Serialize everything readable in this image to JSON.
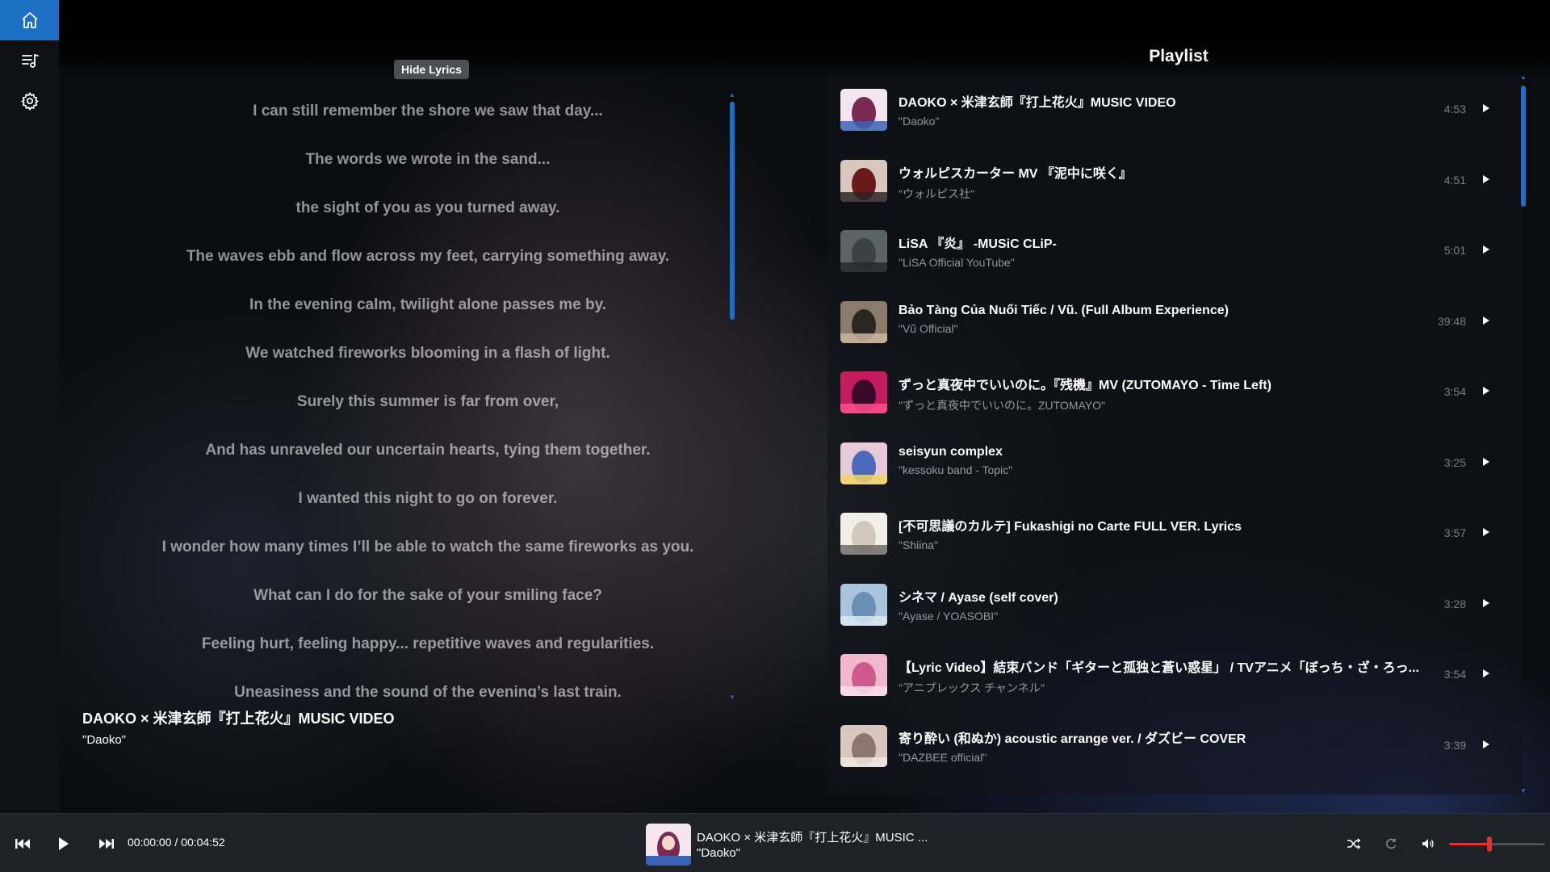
{
  "sidebar": {
    "items": [
      {
        "name": "home",
        "icon": "home-icon",
        "active": true
      },
      {
        "name": "playlist",
        "icon": "playlist-icon",
        "active": false
      },
      {
        "name": "settings",
        "icon": "gear-icon",
        "active": false
      }
    ]
  },
  "lyrics": {
    "toggle_label": "Hide Lyrics",
    "lines": [
      "I can still remember the shore we saw that day...",
      "The words we wrote in the sand...",
      "the sight of you as you turned away.",
      "The waves ebb and flow across my feet, carrying something away.",
      "In the evening calm, twilight alone passes me by.",
      "We watched fireworks blooming in a flash of light.",
      "Surely this summer is far from over,",
      "And has unraveled our uncertain hearts, tying them together.",
      "I wanted this night to go on forever.",
      "I wonder how many times I’ll be able to watch the same fireworks as you.",
      "What can I do for the sake of your smiling face?",
      "Feeling hurt, feeling happy... repetitive waves and regularities.",
      "Uneasiness and the sound of the evening’s last train."
    ],
    "scroll_position": 0.0
  },
  "now_playing": {
    "title": "DAOKO × 米津玄師『打上花火』MUSIC VIDEO",
    "artist": "\"Daoko\""
  },
  "playlist": {
    "header": "Playlist",
    "items": [
      {
        "title": "DAOKO × 米津玄師『打上花火』MUSIC VIDEO",
        "artist": "\"Daoko\"",
        "duration": "4:53",
        "thumb_colors": [
          "#f3e6ef",
          "#7a2a52",
          "#3a63b6"
        ]
      },
      {
        "title": "ウォルピスカーター MV 『泥中に咲く』",
        "artist": "\"ウォルピス社\"",
        "duration": "4:51",
        "thumb_colors": [
          "#d9c6bd",
          "#6b1a1a",
          "#2d2326"
        ]
      },
      {
        "title": "LiSA 『炎』 -MUSiC CLiP-",
        "artist": "\"LiSA Official YouTube\"",
        "duration": "5:01",
        "thumb_colors": [
          "#5b6464",
          "#3a4242",
          "#232a2a"
        ]
      },
      {
        "title": "Bảo Tàng Của Nuối Tiếc / Vũ. (Full Album Experience)",
        "artist": "\"Vũ Official\"",
        "duration": "39:48",
        "thumb_colors": [
          "#8a7b6a",
          "#2c2622",
          "#c7b7a0"
        ]
      },
      {
        "title": "ずっと真夜中でいいのに。『残機』MV (ZUTOMAYO - Time Left)",
        "artist": "\"ずっと真夜中でいいのに。ZUTOMAYO\"",
        "duration": "3:54",
        "thumb_colors": [
          "#c41c5e",
          "#3a0a2a",
          "#ff4f8e"
        ]
      },
      {
        "title": "seisyun complex",
        "artist": "\"kessoku band - Topic\"",
        "duration": "3:25",
        "thumb_colors": [
          "#e8c9d8",
          "#4a6bbb",
          "#f1d36b"
        ]
      },
      {
        "title": "[不可思議のカルテ] Fukashigi no Carte FULL VER. Lyrics",
        "artist": "\"Shiina\"",
        "duration": "3:57",
        "thumb_colors": [
          "#f2efe8",
          "#d1c7bc",
          "#6e6a65"
        ]
      },
      {
        "title": "シネマ / Ayase (self cover)",
        "artist": "\"Ayase / YOASOBI\"",
        "duration": "3:28",
        "thumb_colors": [
          "#a8c4dc",
          "#6b8fb3",
          "#dce8f2"
        ]
      },
      {
        "title": "【Lyric Video】結束バンド「ギターと孤独と蒼い惑星」 / TVアニメ「ぼっち・ざ・ろっ...",
        "artist": "\"アニプレックス チャンネル\"",
        "duration": "3:54",
        "thumb_colors": [
          "#f2b6cf",
          "#cf5a8e",
          "#f7e1ea"
        ]
      },
      {
        "title": "寄り酔い (和ぬか) acoustic arrange ver. / ダズビー COVER",
        "artist": "\"DAZBEE official\"",
        "duration": "3:39",
        "thumb_colors": [
          "#d9c7bf",
          "#8d766c",
          "#efe6e1"
        ]
      }
    ]
  },
  "player": {
    "time": "00:00:00 / 00:04:52",
    "current_title": "DAOKO × 米津玄師『打上花火』MUSIC ...",
    "current_artist": "\"Daoko\"",
    "volume": 0.42,
    "accent_color": "#1d6fc4",
    "volume_color": "#e23030"
  }
}
